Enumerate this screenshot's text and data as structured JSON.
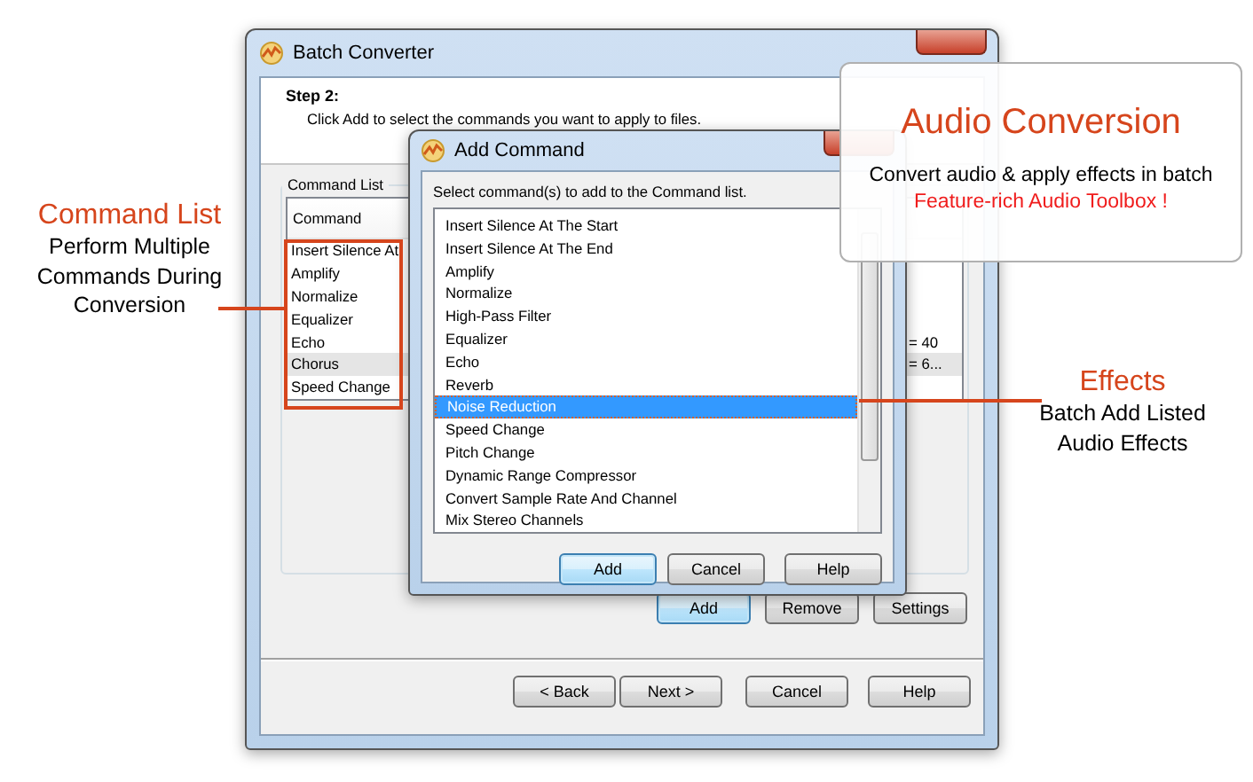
{
  "main_window": {
    "title": "Batch Converter",
    "step_title": "Step 2:",
    "step_description": "Click Add to select the commands you want to apply to files.",
    "group_label": "Command List",
    "list": {
      "columns": [
        "Command"
      ],
      "rows": [
        {
          "command": "Insert Silence At",
          "selected": false
        },
        {
          "command": "Amplify",
          "selected": false
        },
        {
          "command": "Normalize",
          "selected": false
        },
        {
          "command": "Equalizer",
          "selected": false
        },
        {
          "command": "Echo",
          "column_2": "= 40",
          "selected": false
        },
        {
          "command": "Chorus",
          "column_2": "= 6...",
          "selected": true
        },
        {
          "command": "Speed Change",
          "selected": false
        }
      ]
    },
    "buttons": [
      {
        "label": "Add",
        "default": true
      },
      {
        "label": "Remove",
        "default": false
      },
      {
        "label": "Settings",
        "default": false
      }
    ],
    "nav_buttons": [
      {
        "label": "< Back",
        "default": false
      },
      {
        "label": "Next >",
        "default": false
      },
      {
        "label": "Cancel",
        "default": false
      },
      {
        "label": "Help",
        "default": false
      }
    ]
  },
  "dialog": {
    "title": "Add Command",
    "prompt": "Select command(s) to add to the Command list.",
    "items": [
      {
        "label": "Insert Silence At The Start",
        "selected": false
      },
      {
        "label": "Insert Silence At The End",
        "selected": false
      },
      {
        "label": "Amplify",
        "selected": false
      },
      {
        "label": "Normalize",
        "selected": false
      },
      {
        "label": "High-Pass Filter",
        "selected": false
      },
      {
        "label": "Equalizer",
        "selected": false
      },
      {
        "label": "Echo",
        "selected": false
      },
      {
        "label": "Reverb",
        "selected": false
      },
      {
        "label": "Noise Reduction",
        "selected": true
      },
      {
        "label": "Speed Change",
        "selected": false
      },
      {
        "label": "Pitch Change",
        "selected": false
      },
      {
        "label": "Dynamic Range Compressor",
        "selected": false
      },
      {
        "label": "Convert Sample Rate And Channel",
        "selected": false
      },
      {
        "label": "Mix Stereo Channels",
        "selected": false
      }
    ],
    "buttons": [
      {
        "label": "Add",
        "default": true
      },
      {
        "label": "Cancel",
        "default": false
      },
      {
        "label": "Help",
        "default": false
      }
    ]
  },
  "callouts": {
    "audio_conversion": {
      "title": "Audio Conversion",
      "text": "Convert audio & apply effects in batch",
      "highlight": "Feature-rich Audio Toolbox !"
    },
    "command_list": {
      "title": "Command List",
      "lines": [
        "Perform Multiple",
        "Commands During",
        "Conversion"
      ]
    },
    "effects": {
      "title": "Effects",
      "lines": [
        "Batch Add Listed",
        "Audio Effects"
      ]
    }
  }
}
